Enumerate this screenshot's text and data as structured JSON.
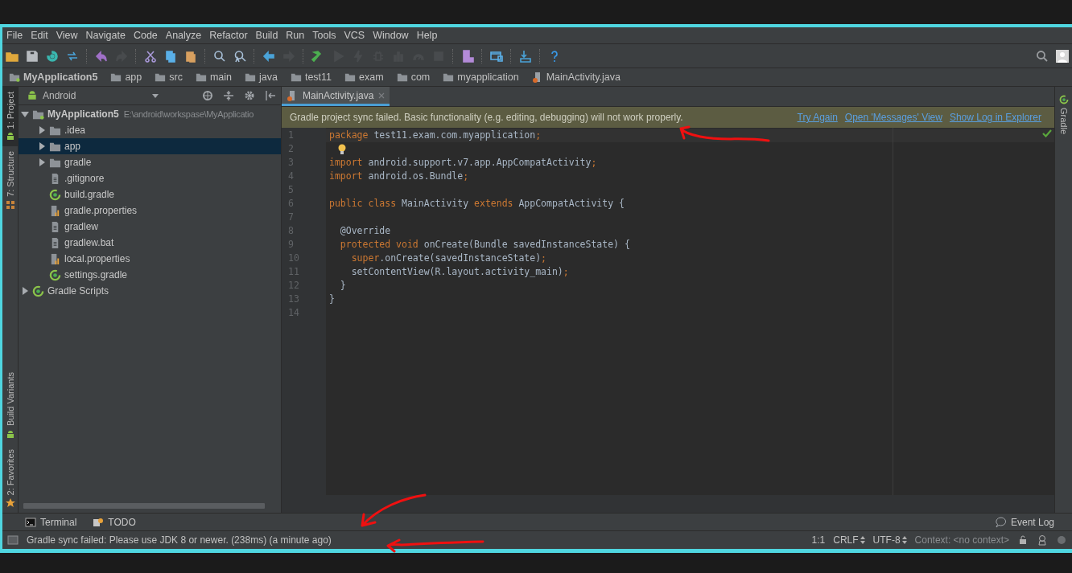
{
  "menu": [
    "File",
    "Edit",
    "View",
    "Navigate",
    "Code",
    "Analyze",
    "Refactor",
    "Build",
    "Run",
    "Tools",
    "VCS",
    "Window",
    "Help"
  ],
  "toolbar": [
    {
      "kind": "open",
      "disabled": false
    },
    {
      "kind": "save",
      "disabled": false
    },
    {
      "kind": "sync",
      "disabled": false
    },
    {
      "kind": "refresh",
      "disabled": false
    },
    {
      "kind": "separator"
    },
    {
      "kind": "undo",
      "disabled": false
    },
    {
      "kind": "redo",
      "disabled": true
    },
    {
      "kind": "separator"
    },
    {
      "kind": "cut",
      "disabled": false
    },
    {
      "kind": "copy",
      "disabled": false
    },
    {
      "kind": "paste",
      "disabled": false
    },
    {
      "kind": "separator"
    },
    {
      "kind": "find",
      "disabled": false
    },
    {
      "kind": "replace",
      "disabled": false
    },
    {
      "kind": "separator"
    },
    {
      "kind": "back",
      "disabled": false
    },
    {
      "kind": "forward",
      "disabled": true
    },
    {
      "kind": "separator"
    },
    {
      "kind": "build",
      "disabled": false
    },
    {
      "kind": "run",
      "disabled": true
    },
    {
      "kind": "bolt",
      "disabled": true
    },
    {
      "kind": "debug",
      "disabled": true
    },
    {
      "kind": "coverage",
      "disabled": true
    },
    {
      "kind": "profile",
      "disabled": true
    },
    {
      "kind": "stop",
      "disabled": true
    },
    {
      "kind": "separator"
    },
    {
      "kind": "avd",
      "disabled": false
    },
    {
      "kind": "separator"
    },
    {
      "kind": "sdk",
      "disabled": false
    },
    {
      "kind": "separator"
    },
    {
      "kind": "device",
      "disabled": false
    },
    {
      "kind": "separator"
    },
    {
      "kind": "help",
      "disabled": false
    }
  ],
  "breadcrumbs": [
    {
      "label": "MyApplication5",
      "kind": "project"
    },
    {
      "label": "app",
      "kind": "folder"
    },
    {
      "label": "src",
      "kind": "folder"
    },
    {
      "label": "main",
      "kind": "folder"
    },
    {
      "label": "java",
      "kind": "folder"
    },
    {
      "label": "test11",
      "kind": "folder"
    },
    {
      "label": "exam",
      "kind": "folder"
    },
    {
      "label": "com",
      "kind": "folder"
    },
    {
      "label": "myapplication",
      "kind": "folder"
    },
    {
      "label": "MainActivity.java",
      "kind": "java"
    }
  ],
  "left_tabs": [
    {
      "label": "1: Project",
      "selected": true,
      "kind": "android"
    },
    {
      "label": "7: Structure",
      "selected": false,
      "kind": "structure"
    },
    {
      "label": "Build Variants",
      "selected": false,
      "kind": "android"
    },
    {
      "label": "2: Favorites",
      "selected": false,
      "kind": "star"
    }
  ],
  "project": {
    "view": "Android",
    "tree": [
      {
        "label": "MyApplication5",
        "path": "E:\\android\\workspase\\MyApplicatio",
        "kind": "project",
        "expanded": true,
        "selected": false,
        "children": [
          {
            "label": ".idea",
            "kind": "folder",
            "expanded": false,
            "selected": false
          },
          {
            "label": "app",
            "kind": "folder",
            "expanded": false,
            "selected": true
          },
          {
            "label": "gradle",
            "kind": "folder",
            "expanded": false,
            "selected": false
          },
          {
            "label": ".gitignore",
            "kind": "file",
            "selected": false
          },
          {
            "label": "build.gradle",
            "kind": "gradle",
            "selected": false
          },
          {
            "label": "gradle.properties",
            "kind": "properties",
            "selected": false
          },
          {
            "label": "gradlew",
            "kind": "file",
            "selected": false
          },
          {
            "label": "gradlew.bat",
            "kind": "file",
            "selected": false
          },
          {
            "label": "local.properties",
            "kind": "properties",
            "selected": false
          },
          {
            "label": "settings.gradle",
            "kind": "gradle",
            "selected": false
          }
        ]
      },
      {
        "label": "Gradle Scripts",
        "kind": "gradle",
        "expanded": false,
        "selected": false
      }
    ]
  },
  "editor": {
    "tabs": [
      {
        "label": "MainActivity.java",
        "selected": true
      }
    ],
    "banner": {
      "message": "Gradle project sync failed. Basic functionality (e.g. editing, debugging) will not work properly.",
      "links": [
        "Try Again",
        "Open 'Messages' View",
        "Show Log in Explorer"
      ]
    },
    "lines": [
      {
        "number": "1",
        "tokens": [
          {
            "text": "package",
            "kind": "keyword"
          },
          {
            "text": " test11.exam.com.myapplication",
            "kind": "plain"
          },
          {
            "text": ";",
            "kind": "keyword"
          }
        ]
      },
      {
        "number": "2",
        "bulb": true
      },
      {
        "number": "3",
        "tokens": [
          {
            "text": "import",
            "kind": "keyword"
          },
          {
            "text": " android.support.v7.app.AppCompatActivity",
            "kind": "plain"
          },
          {
            "text": ";",
            "kind": "keyword"
          }
        ]
      },
      {
        "number": "4",
        "tokens": [
          {
            "text": "import",
            "kind": "keyword"
          },
          {
            "text": " android.os.Bundle",
            "kind": "plain"
          },
          {
            "text": ";",
            "kind": "keyword"
          }
        ]
      },
      {
        "number": "5"
      },
      {
        "number": "6",
        "tokens": [
          {
            "text": "public class",
            "kind": "keyword"
          },
          {
            "text": " MainActivity ",
            "kind": "plain"
          },
          {
            "text": "extends",
            "kind": "keyword"
          },
          {
            "text": " AppCompatActivity {",
            "kind": "plain"
          }
        ]
      },
      {
        "number": "7"
      },
      {
        "number": "8",
        "tokens": [
          {
            "text": "  @Override",
            "kind": "plain"
          }
        ]
      },
      {
        "number": "9",
        "tokens": [
          {
            "text": "  protected void",
            "kind": "keyword"
          },
          {
            "text": " onCreate(Bundle savedInstanceState) {",
            "kind": "plain"
          }
        ]
      },
      {
        "number": "10",
        "tokens": [
          {
            "text": "    super",
            "kind": "keyword"
          },
          {
            "text": ".onCreate(savedInstanceState)",
            "kind": "plain"
          },
          {
            "text": ";",
            "kind": "keyword"
          }
        ]
      },
      {
        "number": "11",
        "tokens": [
          {
            "text": "    setContentView(R.layout.activity_main)",
            "kind": "plain"
          },
          {
            "text": ";",
            "kind": "keyword"
          }
        ]
      },
      {
        "number": "12",
        "tokens": [
          {
            "text": "  }",
            "kind": "plain"
          }
        ]
      },
      {
        "number": "13",
        "tokens": [
          {
            "text": "}",
            "kind": "plain"
          }
        ]
      },
      {
        "number": "14"
      }
    ]
  },
  "right_tabs": [
    {
      "label": "Gradle",
      "selected": false
    }
  ],
  "bottom_tabs": [
    {
      "label": "Terminal",
      "kind": "terminal"
    },
    {
      "label": "TODO",
      "kind": "todo"
    }
  ],
  "event_log": "Event Log",
  "status_bar": {
    "message": "Gradle sync failed: Please use JDK 8 or newer. (238ms) (a minute ago)",
    "position": "1:1",
    "line_separator": "CRLF",
    "encoding": "UTF-8",
    "context": "Context: <no context>"
  }
}
